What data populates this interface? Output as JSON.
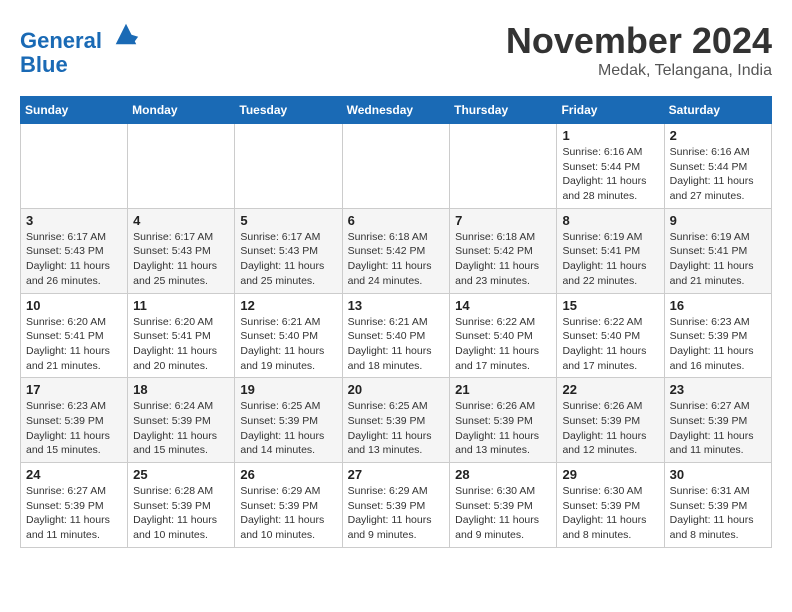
{
  "logo": {
    "line1": "General",
    "line2": "Blue"
  },
  "title": "November 2024",
  "location": "Medak, Telangana, India",
  "weekdays": [
    "Sunday",
    "Monday",
    "Tuesday",
    "Wednesday",
    "Thursday",
    "Friday",
    "Saturday"
  ],
  "weeks": [
    [
      {
        "day": "",
        "info": ""
      },
      {
        "day": "",
        "info": ""
      },
      {
        "day": "",
        "info": ""
      },
      {
        "day": "",
        "info": ""
      },
      {
        "day": "",
        "info": ""
      },
      {
        "day": "1",
        "info": "Sunrise: 6:16 AM\nSunset: 5:44 PM\nDaylight: 11 hours and 28 minutes."
      },
      {
        "day": "2",
        "info": "Sunrise: 6:16 AM\nSunset: 5:44 PM\nDaylight: 11 hours and 27 minutes."
      }
    ],
    [
      {
        "day": "3",
        "info": "Sunrise: 6:17 AM\nSunset: 5:43 PM\nDaylight: 11 hours and 26 minutes."
      },
      {
        "day": "4",
        "info": "Sunrise: 6:17 AM\nSunset: 5:43 PM\nDaylight: 11 hours and 25 minutes."
      },
      {
        "day": "5",
        "info": "Sunrise: 6:17 AM\nSunset: 5:43 PM\nDaylight: 11 hours and 25 minutes."
      },
      {
        "day": "6",
        "info": "Sunrise: 6:18 AM\nSunset: 5:42 PM\nDaylight: 11 hours and 24 minutes."
      },
      {
        "day": "7",
        "info": "Sunrise: 6:18 AM\nSunset: 5:42 PM\nDaylight: 11 hours and 23 minutes."
      },
      {
        "day": "8",
        "info": "Sunrise: 6:19 AM\nSunset: 5:41 PM\nDaylight: 11 hours and 22 minutes."
      },
      {
        "day": "9",
        "info": "Sunrise: 6:19 AM\nSunset: 5:41 PM\nDaylight: 11 hours and 21 minutes."
      }
    ],
    [
      {
        "day": "10",
        "info": "Sunrise: 6:20 AM\nSunset: 5:41 PM\nDaylight: 11 hours and 21 minutes."
      },
      {
        "day": "11",
        "info": "Sunrise: 6:20 AM\nSunset: 5:41 PM\nDaylight: 11 hours and 20 minutes."
      },
      {
        "day": "12",
        "info": "Sunrise: 6:21 AM\nSunset: 5:40 PM\nDaylight: 11 hours and 19 minutes."
      },
      {
        "day": "13",
        "info": "Sunrise: 6:21 AM\nSunset: 5:40 PM\nDaylight: 11 hours and 18 minutes."
      },
      {
        "day": "14",
        "info": "Sunrise: 6:22 AM\nSunset: 5:40 PM\nDaylight: 11 hours and 17 minutes."
      },
      {
        "day": "15",
        "info": "Sunrise: 6:22 AM\nSunset: 5:40 PM\nDaylight: 11 hours and 17 minutes."
      },
      {
        "day": "16",
        "info": "Sunrise: 6:23 AM\nSunset: 5:39 PM\nDaylight: 11 hours and 16 minutes."
      }
    ],
    [
      {
        "day": "17",
        "info": "Sunrise: 6:23 AM\nSunset: 5:39 PM\nDaylight: 11 hours and 15 minutes."
      },
      {
        "day": "18",
        "info": "Sunrise: 6:24 AM\nSunset: 5:39 PM\nDaylight: 11 hours and 15 minutes."
      },
      {
        "day": "19",
        "info": "Sunrise: 6:25 AM\nSunset: 5:39 PM\nDaylight: 11 hours and 14 minutes."
      },
      {
        "day": "20",
        "info": "Sunrise: 6:25 AM\nSunset: 5:39 PM\nDaylight: 11 hours and 13 minutes."
      },
      {
        "day": "21",
        "info": "Sunrise: 6:26 AM\nSunset: 5:39 PM\nDaylight: 11 hours and 13 minutes."
      },
      {
        "day": "22",
        "info": "Sunrise: 6:26 AM\nSunset: 5:39 PM\nDaylight: 11 hours and 12 minutes."
      },
      {
        "day": "23",
        "info": "Sunrise: 6:27 AM\nSunset: 5:39 PM\nDaylight: 11 hours and 11 minutes."
      }
    ],
    [
      {
        "day": "24",
        "info": "Sunrise: 6:27 AM\nSunset: 5:39 PM\nDaylight: 11 hours and 11 minutes."
      },
      {
        "day": "25",
        "info": "Sunrise: 6:28 AM\nSunset: 5:39 PM\nDaylight: 11 hours and 10 minutes."
      },
      {
        "day": "26",
        "info": "Sunrise: 6:29 AM\nSunset: 5:39 PM\nDaylight: 11 hours and 10 minutes."
      },
      {
        "day": "27",
        "info": "Sunrise: 6:29 AM\nSunset: 5:39 PM\nDaylight: 11 hours and 9 minutes."
      },
      {
        "day": "28",
        "info": "Sunrise: 6:30 AM\nSunset: 5:39 PM\nDaylight: 11 hours and 9 minutes."
      },
      {
        "day": "29",
        "info": "Sunrise: 6:30 AM\nSunset: 5:39 PM\nDaylight: 11 hours and 8 minutes."
      },
      {
        "day": "30",
        "info": "Sunrise: 6:31 AM\nSunset: 5:39 PM\nDaylight: 11 hours and 8 minutes."
      }
    ]
  ]
}
